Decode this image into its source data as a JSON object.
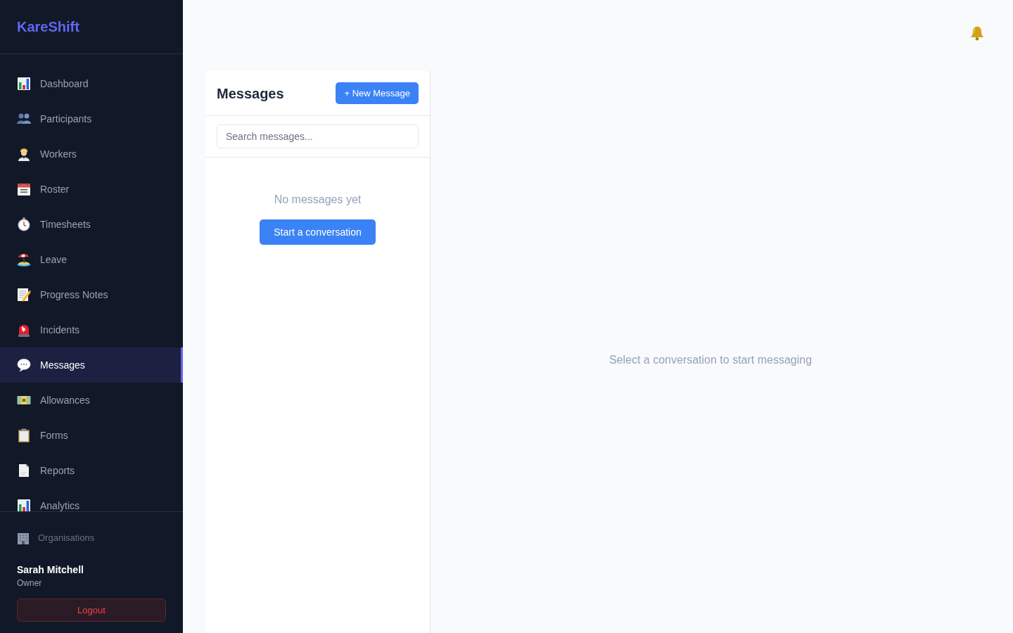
{
  "sidebar": {
    "logo": "KareShift",
    "nav_items": [
      {
        "label": "Dashboard",
        "selected": false
      },
      {
        "label": "Participants",
        "selected": false
      },
      {
        "label": "Workers",
        "selected": false
      },
      {
        "label": "Roster",
        "selected": false
      },
      {
        "label": "Timesheets",
        "selected": false
      },
      {
        "label": "Leave",
        "selected": false
      },
      {
        "label": "Progress Notes",
        "selected": false
      },
      {
        "label": "Incidents",
        "selected": false
      },
      {
        "label": "Messages",
        "selected": true
      },
      {
        "label": "Allowances",
        "selected": false
      },
      {
        "label": "Forms",
        "selected": false
      },
      {
        "label": "Reports",
        "selected": false
      },
      {
        "label": "Analytics",
        "selected": false
      }
    ],
    "organisations_link": "Organisations",
    "user": {
      "name": "Sarah Mitchell",
      "role": "Owner"
    },
    "logout_button": "Logout"
  },
  "messages_panel": {
    "title": "Messages",
    "new_message_button": "+ New Message",
    "search": {
      "placeholder": "Search messages..."
    },
    "empty_text": "No messages yet",
    "start_button": "Start a conversation"
  },
  "conversation_panel": {
    "empty_text": "Select a conversation to start messaging"
  }
}
